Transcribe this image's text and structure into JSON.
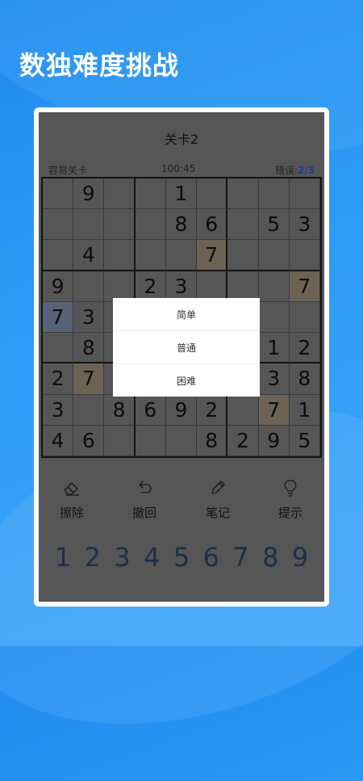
{
  "headline": "数独难度挑战",
  "game": {
    "level_title": "关卡2",
    "difficulty_label": "容易关卡",
    "timer": "100:45",
    "errors_label": "错误:",
    "errors_count": "2/3"
  },
  "grid": {
    "rows": [
      [
        "",
        "9",
        "",
        "",
        "1",
        "",
        "",
        "",
        ""
      ],
      [
        "",
        "",
        "",
        "",
        "8",
        "6",
        "",
        "5",
        "3"
      ],
      [
        "",
        "4",
        "",
        "",
        "",
        "7",
        "",
        "",
        ""
      ],
      [
        "9",
        "",
        "",
        "2",
        "3",
        "",
        "",
        "",
        "7"
      ],
      [
        "7",
        "3",
        "",
        "",
        "",
        "",
        "",
        "",
        ""
      ],
      [
        "",
        "8",
        "",
        "",
        "",
        "",
        "",
        "1",
        "2"
      ],
      [
        "2",
        "7",
        "",
        "",
        "",
        "",
        "",
        "3",
        "8"
      ],
      [
        "3",
        "",
        "8",
        "6",
        "9",
        "2",
        "",
        "7",
        "1"
      ],
      [
        "4",
        "6",
        "",
        "",
        "",
        "8",
        "2",
        "9",
        "5"
      ]
    ]
  },
  "difficulty_dialog": {
    "options": [
      "简单",
      "普通",
      "困难"
    ]
  },
  "tools": [
    {
      "label": "擦除",
      "icon": "eraser-icon"
    },
    {
      "label": "撤回",
      "icon": "undo-icon"
    },
    {
      "label": "笔记",
      "icon": "pencil-icon"
    },
    {
      "label": "提示",
      "icon": "lightbulb-icon"
    }
  ],
  "number_pad": [
    "1",
    "2",
    "3",
    "4",
    "5",
    "6",
    "7",
    "8",
    "9"
  ],
  "colors": {
    "background": "#2f9bf5",
    "overlay": "#565656",
    "highlight_orange": "#6e6254",
    "highlight_blue": "#586378",
    "error_count": "#1d3f9a"
  }
}
